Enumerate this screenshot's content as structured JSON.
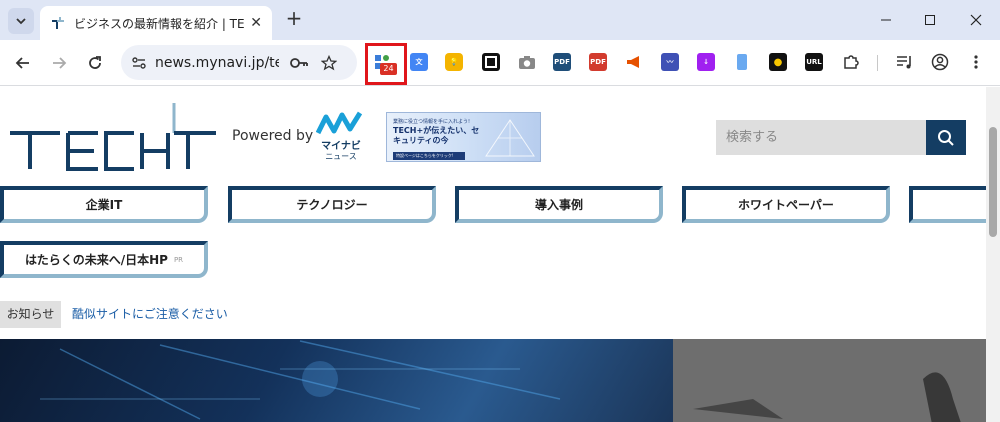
{
  "browser": {
    "tab_title": "ビジネスの最新情報を紹介 | TECH+",
    "url": "news.mynavi.jp/te...",
    "extension_badge": "24",
    "ext_labels": {
      "pdf1": "PDF",
      "pdf2": "PDF",
      "url": "URL"
    }
  },
  "site": {
    "powered_by": "Powered by",
    "partner_logo_text": "マイナビ",
    "partner_logo_sub": "ニュース",
    "banner": {
      "small": "業務に役立つ情報を手に入れよう!",
      "main": "TECH+が伝えたい、セキュリティの今",
      "button": "特設ページはこちらをクリック!"
    },
    "search_placeholder": "検索する",
    "nav": [
      {
        "label": "企業IT"
      },
      {
        "label": "テクノロジー"
      },
      {
        "label": "導入事例"
      },
      {
        "label": "ホワイトペーパー"
      },
      {
        "label": ""
      }
    ],
    "nav_row2": {
      "label": "はたらくの未来へ/日本HP",
      "pr": "PR"
    },
    "notice": {
      "label": "お知らせ",
      "link": "酷似サイトにご注意ください"
    }
  },
  "colors": {
    "brand_navy": "#143d63",
    "brand_light": "#8fb6cc",
    "highlight_red": "#e0161b"
  }
}
